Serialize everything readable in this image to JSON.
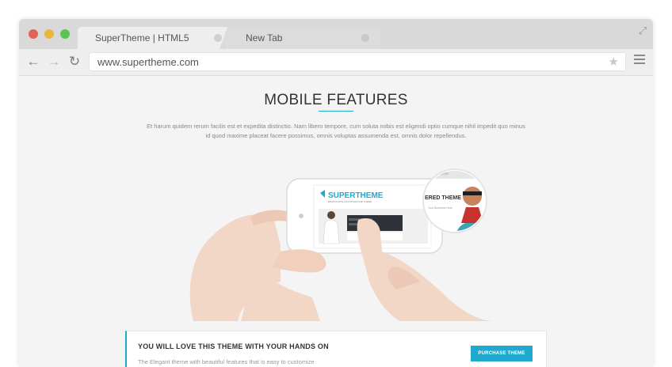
{
  "browser": {
    "tabs": [
      {
        "title": "SuperTheme | HTML5",
        "active": true
      },
      {
        "title": "New Tab",
        "active": false
      }
    ],
    "url": "www.supertheme.com",
    "icons": {
      "back": "arrow-left-icon",
      "forward": "arrow-right-icon",
      "reload": "reload-icon",
      "bookmark": "star-icon",
      "menu": "hamburger-menu-icon",
      "fullscreen": "expand-icon"
    }
  },
  "page": {
    "heading": "MOBILE FEATURES",
    "intro": "Et harum quidem rerum facilis est et expedita distinctio. Nam libero tempore, cum soluta nobis est eligendi optio cumque nihil impedit quo minus id quod maxime placeat facere possimus, omnis voluptas assumenda est, omnis dolor repellendus.",
    "phone": {
      "logo": "SUPERTHEME",
      "logo_tagline": "RESPONSIVE MULTIPURPOSE THEME",
      "magnifier_text": "ERED THEME",
      "magnifier_sub": "Your Business Here"
    },
    "cta": {
      "title": "YOU WILL LOVE THIS THEME WITH YOUR HANDS ON",
      "subtitle": "The Elegant theme with beautiful features that is easy to customize",
      "button": "PURCHASE THEME"
    }
  },
  "colors": {
    "accent": "#21a8cf",
    "titlebar": "#d9d9d9",
    "content_bg": "#f4f4f5"
  }
}
